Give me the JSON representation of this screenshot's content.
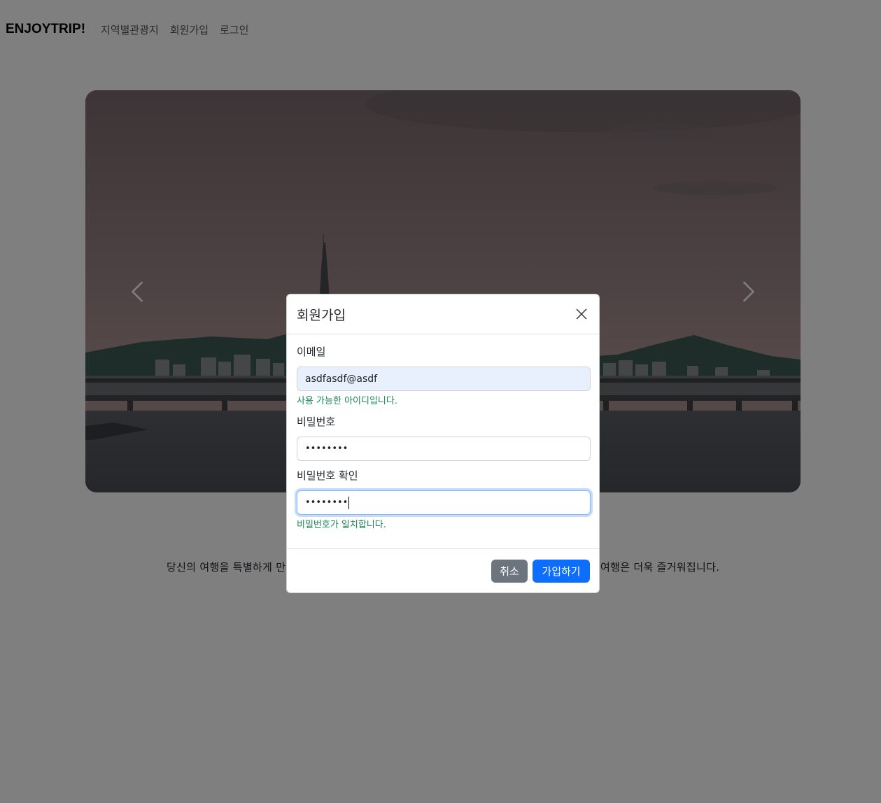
{
  "navbar": {
    "brand": "ENJOYTRIP!",
    "links": [
      "지역별관광지",
      "회원가입",
      "로그인"
    ]
  },
  "carousel": {
    "prev_icon": "chevron-left-icon",
    "next_icon": "chevron-right-icon"
  },
  "intro": {
    "text_left": "당신의 여행을 특별하게 만",
    "text_right": "여행은 더욱 즐거워집니다."
  },
  "modal": {
    "title": "회원가입",
    "close_icon": "close-icon",
    "email": {
      "label": "이메일",
      "value": "asdfasdf@asdf",
      "message": "사용 가능한 아이디입니다."
    },
    "password": {
      "label": "비밀번호",
      "value": "••••••••"
    },
    "password_confirm": {
      "label": "비밀번호 확인",
      "value": "••••••••",
      "message": "비밀번호가 일치합니다."
    },
    "cancel_label": "취소",
    "submit_label": "가입하기"
  },
  "colors": {
    "primary": "#0d6efd",
    "secondary": "#6c757d",
    "success": "#198754",
    "backdrop": "rgba(0,0,0,0.5)"
  }
}
